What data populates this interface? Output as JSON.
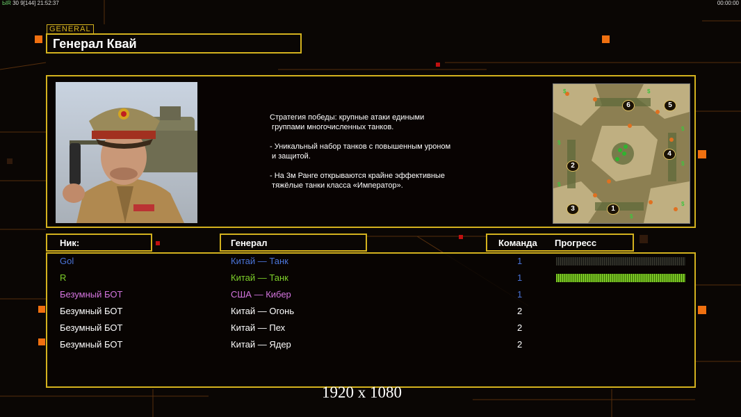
{
  "status_bar": {
    "left_prefix": "ЫR",
    "left_rest": "30 9[144] 21:52:37",
    "right": "00:00:00"
  },
  "general_tag": "GENERAL",
  "title": "Генерал Квай",
  "description": "Стратегия победы: крупные атаки едиными\n группами многочисленных танков.\n\n- Уникальный набор танков с повышенным уроном\n и защитой.\n\n- На 3м Ранге открываются крайне эффективные\n тяжёлые танки класса «Император».",
  "map": {
    "numbers": [
      "6",
      "5",
      "4",
      "2",
      "3",
      "1"
    ],
    "money_symbol": "$"
  },
  "headers": {
    "nick": "Ник:",
    "general": "Генерал",
    "team": "Команда",
    "progress": "Прогресс"
  },
  "players": [
    {
      "nick": "Gol",
      "general": "Китай — Танк",
      "team": "1",
      "color": "#4a74d8",
      "progress": 0.0,
      "progress_track": true
    },
    {
      "nick": "R",
      "general": "Китай — Танк",
      "team": "1",
      "color": "#7ed02a",
      "progress": 1.0,
      "progress_track": true
    },
    {
      "nick": "Безумный БОТ",
      "general": "США — Кибер",
      "team": "1",
      "color": "#d475e0",
      "progress": 0.0,
      "progress_track": false
    },
    {
      "nick": "Безумный БОТ",
      "general": "Китай — Огонь",
      "team": "2",
      "color": "#ffffff",
      "progress": 0.0,
      "progress_track": false
    },
    {
      "nick": "Безумный БОТ",
      "general": "Китай — Пех",
      "team": "2",
      "color": "#ffffff",
      "progress": 0.0,
      "progress_track": false
    },
    {
      "nick": "Безумный БОТ",
      "general": "Китай — Ядер",
      "team": "2",
      "color": "#ffffff",
      "progress": 0.0,
      "progress_track": false
    }
  ],
  "team_color": "#4a74d8",
  "resolution_caption": "1920 x 1080"
}
